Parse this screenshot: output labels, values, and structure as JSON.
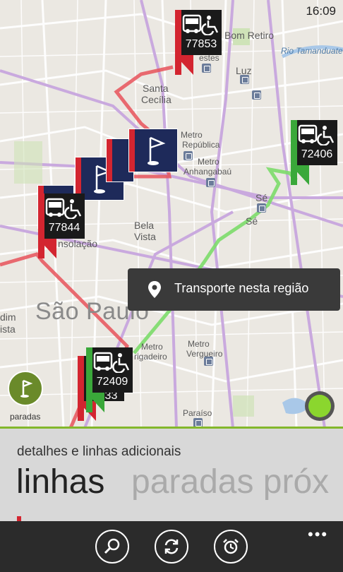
{
  "status_bar": {
    "time": "16:09"
  },
  "map": {
    "labels": {
      "bom_retiro": "Bom Retiro",
      "rio_tamanduatei": "Rio Tamanduate",
      "luz": "Luz",
      "santa_cecilia_1": "Santa",
      "santa_cecilia_2": "Cecília",
      "republica_1": "Metro",
      "republica_2": "República",
      "anhangabau_1": "Metro",
      "anhangabau_2": "Anhangabaú",
      "se_1": "Sé",
      "se_2": "Sé",
      "bela_vista_1": "Bela",
      "bela_vista_2": "Vista",
      "consolacao": "nsolação",
      "sao_paulo": "São Paulo",
      "dim_1": "dim",
      "dim_2": "ista",
      "brigadeiro_1": "Metro",
      "brigadeiro_2": "rigadeiro",
      "vergueiro_1": "Metro",
      "vergueiro_2": "Vergueiro",
      "paraiso": "Paraíso",
      "cestes": "estes"
    },
    "buses": [
      {
        "id": "77853",
        "line_color": "#d32530"
      },
      {
        "id": "72406",
        "line_color": "#3aa83a"
      },
      {
        "id": "77844",
        "line_color": "#d32530"
      },
      {
        "id": "72409",
        "line_color": "#3aa83a"
      }
    ],
    "hidden_bus_suffix": "333",
    "tooltip": {
      "label": "Transporte nesta região",
      "icon": "location-pin-icon"
    },
    "paradas_button": {
      "label": "paradas",
      "icon": "flag-icon"
    },
    "locate_button": {
      "icon": "my-location-icon"
    },
    "colors": {
      "route_red": "#e8525a",
      "route_green": "#7cdc6a",
      "accent_green": "#83b82b"
    }
  },
  "panel": {
    "subtitle": "detalhes e linhas adicionais",
    "pivots": [
      "linhas",
      "paradas próx"
    ]
  },
  "app_bar": {
    "buttons": [
      {
        "icon": "search-icon"
      },
      {
        "icon": "refresh-icon"
      },
      {
        "icon": "alarm-clock-icon"
      }
    ],
    "more": "•••"
  }
}
